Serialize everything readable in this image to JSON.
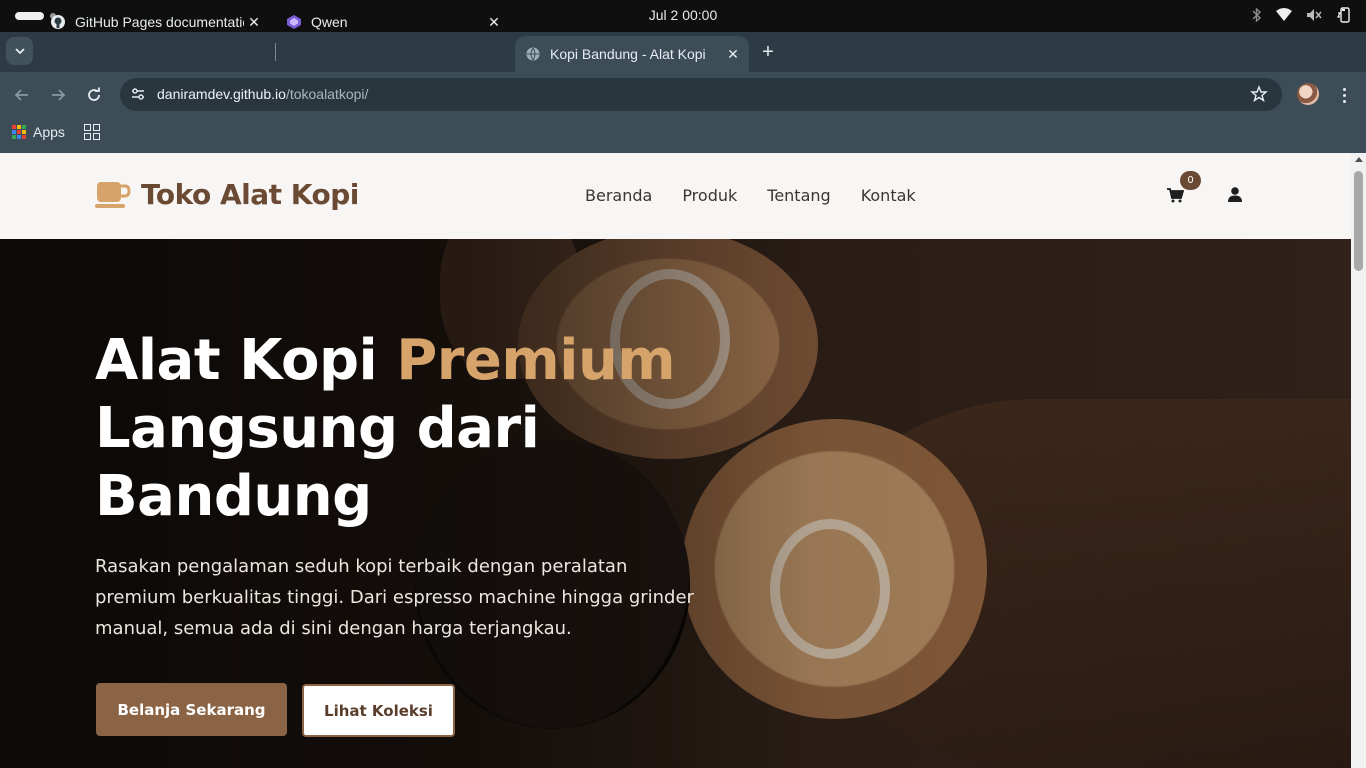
{
  "os": {
    "clock": "Jul 2  00:00"
  },
  "browser": {
    "tabs": [
      {
        "title": "GitHub Pages documentatio",
        "favicon": "github-icon",
        "active": false
      },
      {
        "title": "Qwen",
        "favicon": "qwen-icon",
        "active": false
      },
      {
        "title": "Kopi Bandung - Alat Kopi",
        "favicon": "globe-icon",
        "active": true
      }
    ],
    "url_host": "daniramdev.github.io",
    "url_path": "/tokoalatkopi/",
    "bookmarks": [
      {
        "label": "Apps",
        "icon": "apps-grid-icon"
      }
    ]
  },
  "site": {
    "logo_text": "Toko Alat Kopi",
    "logo_icon": "coffee-cup-icon",
    "nav": [
      "Beranda",
      "Produk",
      "Tentang",
      "Kontak"
    ],
    "cart_count": "0",
    "colors": {
      "brand": "#6b4a33",
      "accent": "#d6a46b",
      "button": "#8b6446"
    }
  },
  "hero": {
    "title_part1": "Alat Kopi ",
    "title_accent": "Premium",
    "title_line2": "Langsung dari",
    "title_line3": "Bandung",
    "description": "Rasakan pengalaman seduh kopi terbaik dengan peralatan premium berkualitas tinggi. Dari espresso machine hingga grinder manual, semua ada di sini dengan harga terjangkau.",
    "primary_button": "Belanja Sekarang",
    "secondary_button": "Lihat Koleksi"
  }
}
